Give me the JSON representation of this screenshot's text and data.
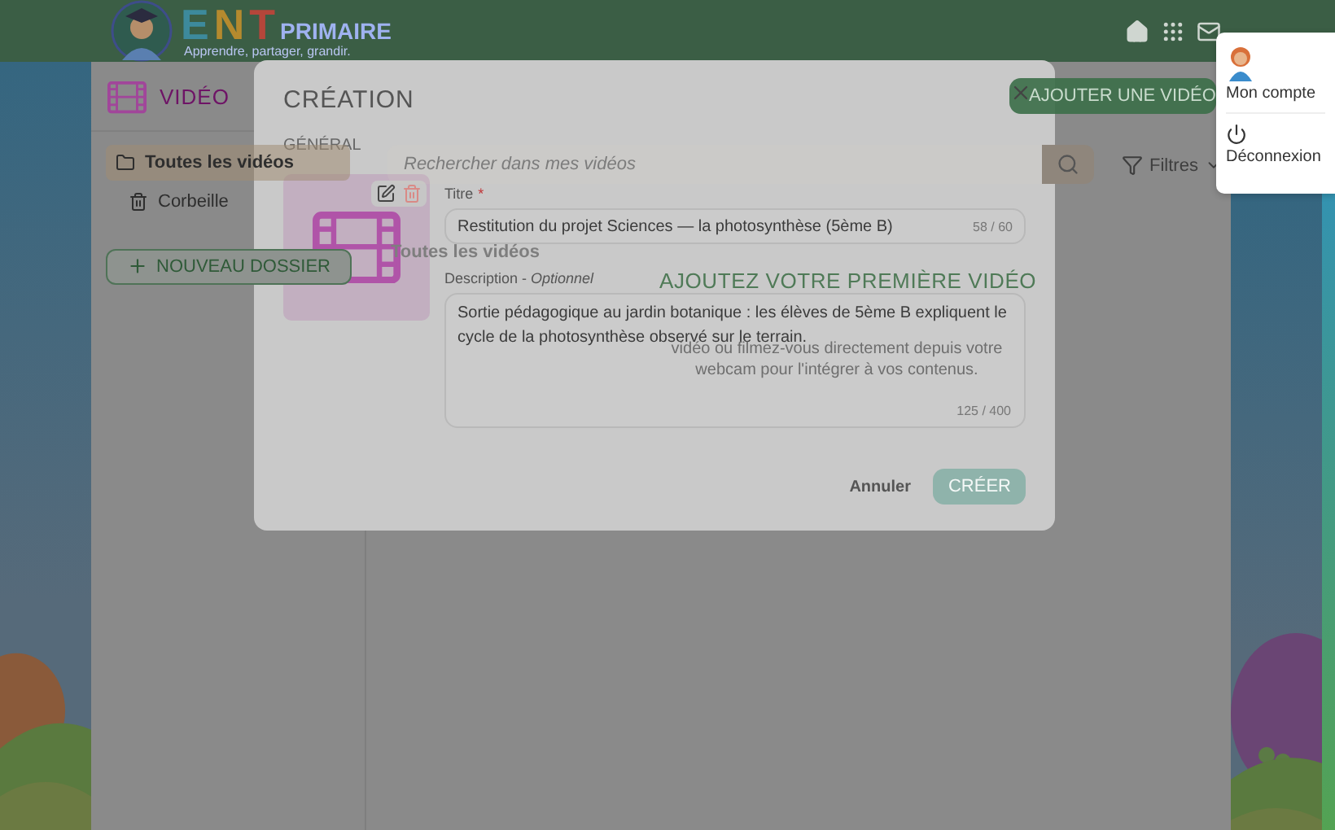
{
  "header": {
    "logo": {
      "letters": [
        {
          "char": "E",
          "color": "#3d8a9c"
        },
        {
          "char": "N",
          "color": "#b58a2e"
        },
        {
          "char": "T",
          "color": "#b5463a"
        }
      ],
      "word": "PRIMAIRE",
      "tagline": "Apprendre, partager, grandir."
    }
  },
  "sidebar": {
    "title": "VIDÉO",
    "items": [
      {
        "label": "Toutes les vidéos",
        "selected": true
      },
      {
        "label": "Corbeille",
        "selected": false
      }
    ],
    "new_folder_button": "NOUVEAU DOSSIER"
  },
  "main": {
    "add_button": "AJOUTER UNE VIDÉO",
    "search": {
      "placeholder": "Rechercher dans mes vidéos"
    },
    "filter_button": "Filtres",
    "section_title": "Toutes les vidéos",
    "empty_state": {
      "title": "AJOUTEZ VOTRE PREMIÈRE VIDÉO",
      "text": "vidéo ou filmez-vous directement depuis votre webcam pour l'intégrer à vos contenus."
    }
  },
  "modal": {
    "title": "CRÉATION",
    "tabs": [
      "GÉNÉRAL"
    ],
    "fields": [
      {
        "kind": "input",
        "label": "Titre",
        "required_mark": "*",
        "value": "Restitution du projet Sciences — la photosynthèse (5ème B)",
        "counter": "58 / 60"
      },
      {
        "kind": "textarea",
        "label": "Description - *Optionnel*",
        "value": "Sortie pédagogique au jardin botanique : les élèves de 5ème B expliquent le cycle de la photosynthèse observé sur le terrain.",
        "counter": "125 / 400"
      }
    ],
    "buttons": [
      {
        "kind": "text",
        "label": "Annuler",
        "disabled": false
      },
      {
        "kind": "primary",
        "label": "CRÉER",
        "disabled": true
      }
    ]
  },
  "account_menu": {
    "items": [
      "Mon compte",
      "Déconnexion"
    ]
  }
}
